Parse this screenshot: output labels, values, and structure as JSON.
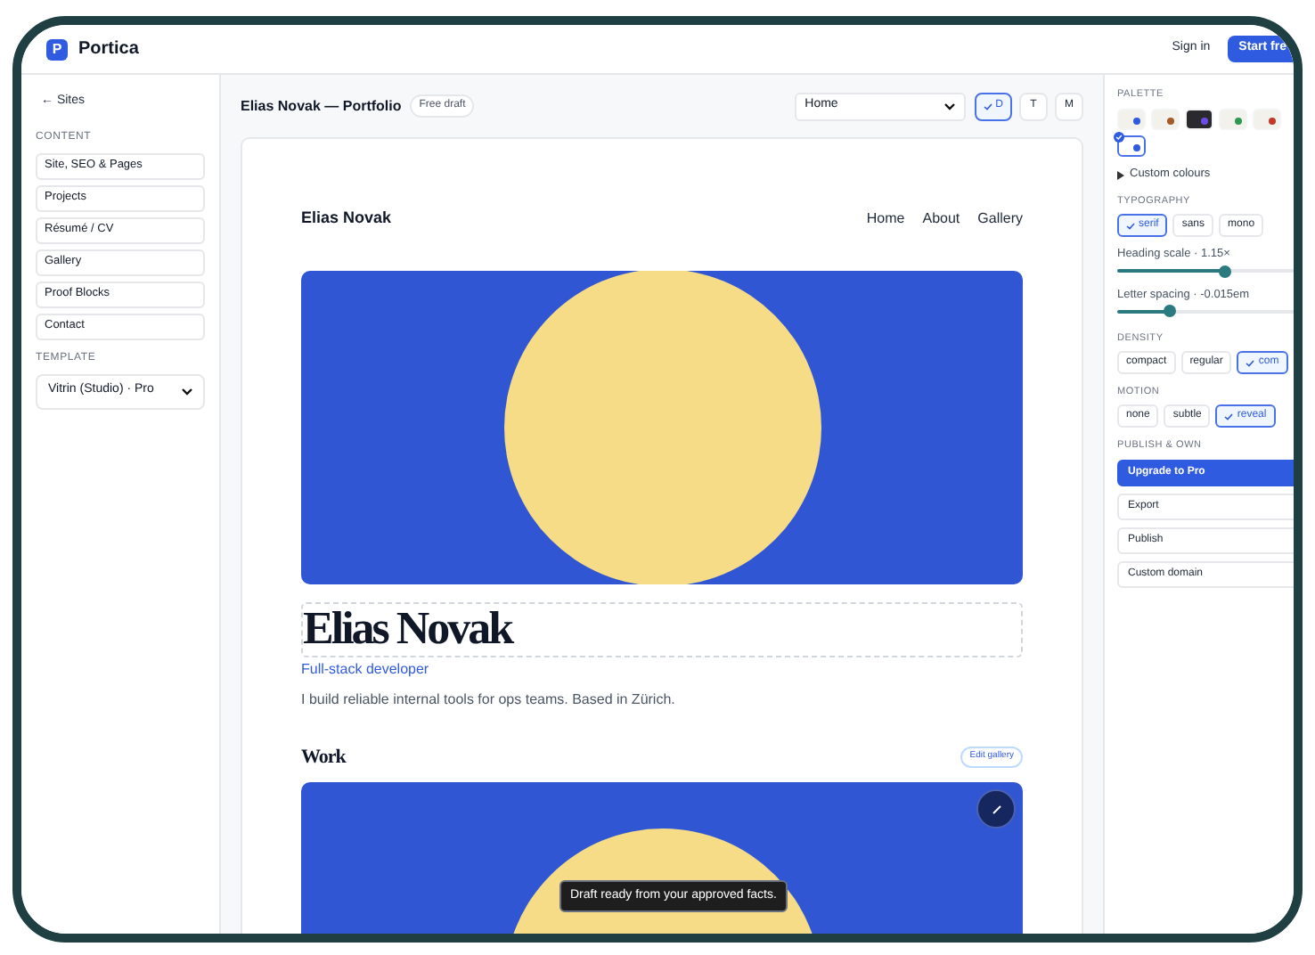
{
  "app": {
    "logo_letter": "P",
    "name": "Portica"
  },
  "top_actions": [
    {
      "label": "Sign in",
      "kind": "link"
    },
    {
      "label": "Start fre",
      "kind": "primary"
    }
  ],
  "sidebar": {
    "back": "← Sites",
    "content_label": "CONTENT",
    "items": [
      "Site, SEO & Pages",
      "Projects",
      "Résumé / CV",
      "Gallery",
      "Proof Blocks",
      "Contact"
    ],
    "template_label": "TEMPLATE",
    "template_value": "Vitrin (Studio) · Pro"
  },
  "editor": {
    "title": "Elias Novak — Portfolio",
    "badge": "Free draft",
    "page_select": "Home",
    "devices": [
      {
        "label": "D",
        "selected": true
      },
      {
        "label": "T",
        "selected": false
      },
      {
        "label": "M",
        "selected": false
      }
    ]
  },
  "preview": {
    "site_name": "Elias Novak",
    "nav": [
      "Home",
      "About",
      "Gallery"
    ],
    "name": "Elias Novak",
    "role": "Full-stack developer",
    "bio": "I build reliable internal tools for ops teams. Based in Zürich.",
    "section_title": "Work",
    "edit_button": "Edit gallery",
    "toast": "Draft ready from your approved facts."
  },
  "panel": {
    "palette_label": "PALETTE",
    "swatches": [
      {
        "color": "#2f5be0",
        "dark": false,
        "selected": false
      },
      {
        "color": "#a65a2a",
        "dark": false,
        "selected": false
      },
      {
        "color": "#6b4ce6",
        "dark": true,
        "selected": false
      },
      {
        "color": "#2e9a4f",
        "dark": false,
        "selected": false
      },
      {
        "color": "#c0392b",
        "dark": false,
        "selected": false
      },
      {
        "color": "#2f5be0",
        "dark": false,
        "selected": true
      }
    ],
    "custom_colours": {
      "label": "Custom colours",
      "expanded": false
    },
    "typography_label": "TYPOGRAPHY",
    "typography": [
      {
        "label": "serif",
        "selected": true
      },
      {
        "label": "sans",
        "selected": false
      },
      {
        "label": "mono",
        "selected": false
      }
    ],
    "sliders": [
      {
        "label": "Heading scale · 1.15×",
        "level": 0.6
      },
      {
        "label": "Letter spacing · -0.015em",
        "level": 0.29
      }
    ],
    "density_label": "DENSITY",
    "density": [
      {
        "label": "compact",
        "selected": false
      },
      {
        "label": "regular",
        "selected": false
      },
      {
        "label": "com",
        "selected": true
      }
    ],
    "motion_label": "MOTION",
    "motion": [
      {
        "label": "none",
        "selected": false
      },
      {
        "label": "subtle",
        "selected": false
      },
      {
        "label": "reveal",
        "selected": true
      }
    ],
    "publish_label": "PUBLISH & OWN",
    "publish": [
      {
        "label": "Upgrade to Pro",
        "kind": "primary"
      },
      {
        "label": "Export",
        "kind": "plain"
      },
      {
        "label": "Publish",
        "kind": "plain"
      },
      {
        "label": "Custom domain",
        "kind": "plain"
      }
    ]
  }
}
